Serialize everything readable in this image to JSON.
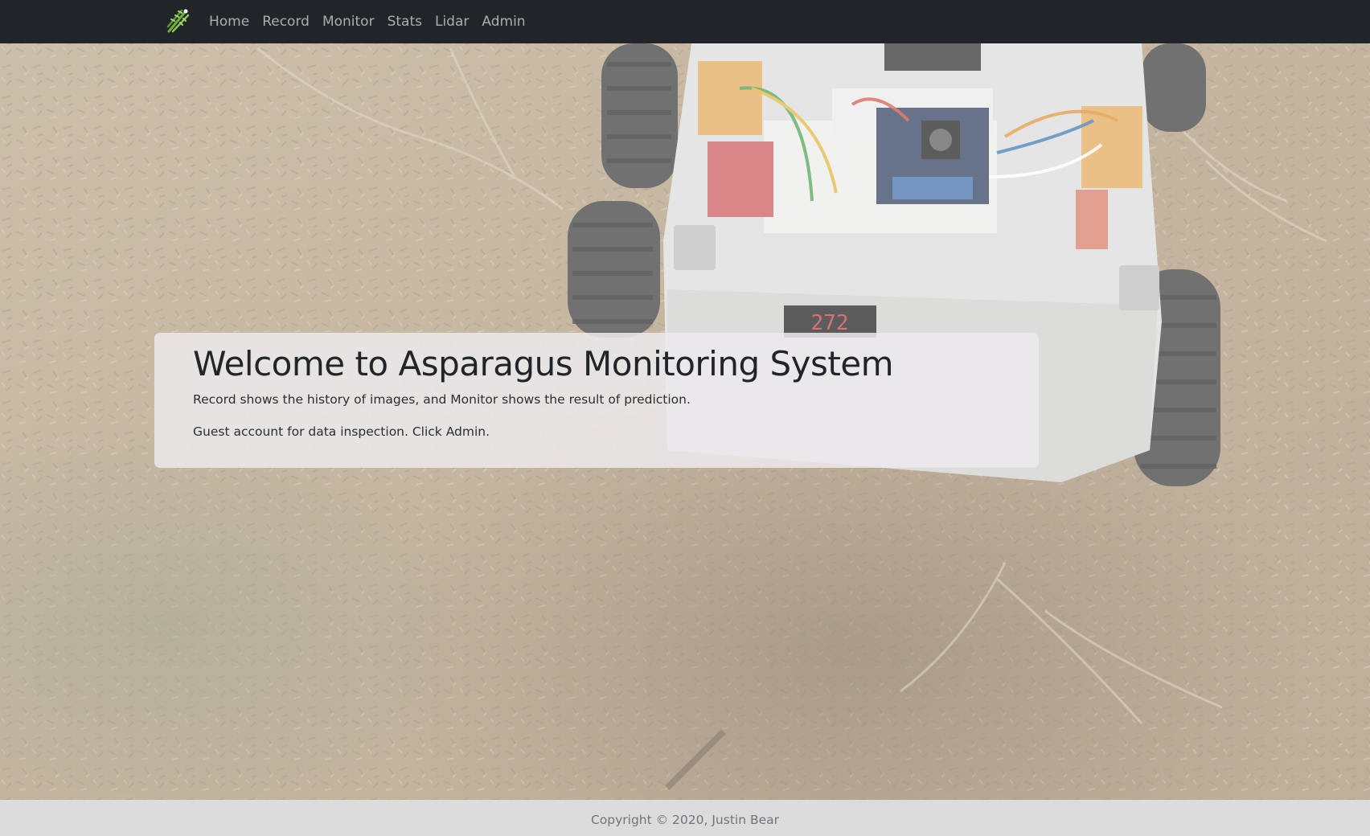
{
  "navbar": {
    "brand_icon": "asparagus-logo-icon",
    "links": [
      "Home",
      "Record",
      "Monitor",
      "Stats",
      "Lidar",
      "Admin"
    ]
  },
  "jumbotron": {
    "title": "Welcome to Asparagus Monitoring System",
    "line1": "Record shows the history of images, and Monitor shows the result of prediction.",
    "line2": "Guest account for data inspection. Click Admin."
  },
  "robot": {
    "display_readout": "272"
  },
  "footer": {
    "copyright": "Copyright © 2020, Justin Bear"
  },
  "colors": {
    "navbar_bg": "#212529",
    "nav_link": "#9ea2a6",
    "jumbotron_bg": "#eceaec",
    "footer_bg": "#dddcdd",
    "footer_text": "#6c757d"
  }
}
